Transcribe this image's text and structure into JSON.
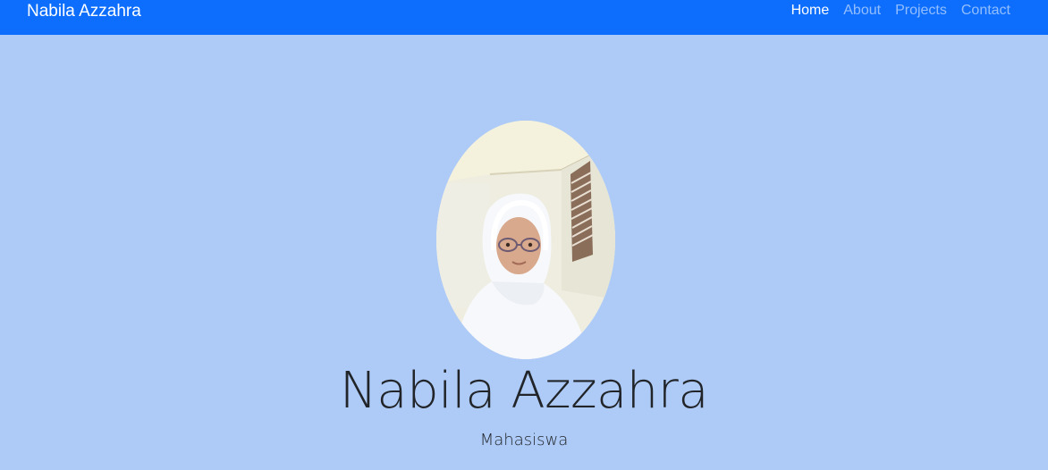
{
  "navbar": {
    "brand": "Nabila Azzahra",
    "links": [
      {
        "label": "Home",
        "active": true
      },
      {
        "label": "About",
        "active": false
      },
      {
        "label": "Projects",
        "active": false
      },
      {
        "label": "Contact",
        "active": false
      }
    ]
  },
  "hero": {
    "name": "Nabila Azzahra",
    "role": "Mahasiswa",
    "photo_alt": "Nabila Azzahra"
  },
  "colors": {
    "navbar_bg": "#0d6efd",
    "page_bg": "#aecbf7",
    "text": "#212529"
  }
}
